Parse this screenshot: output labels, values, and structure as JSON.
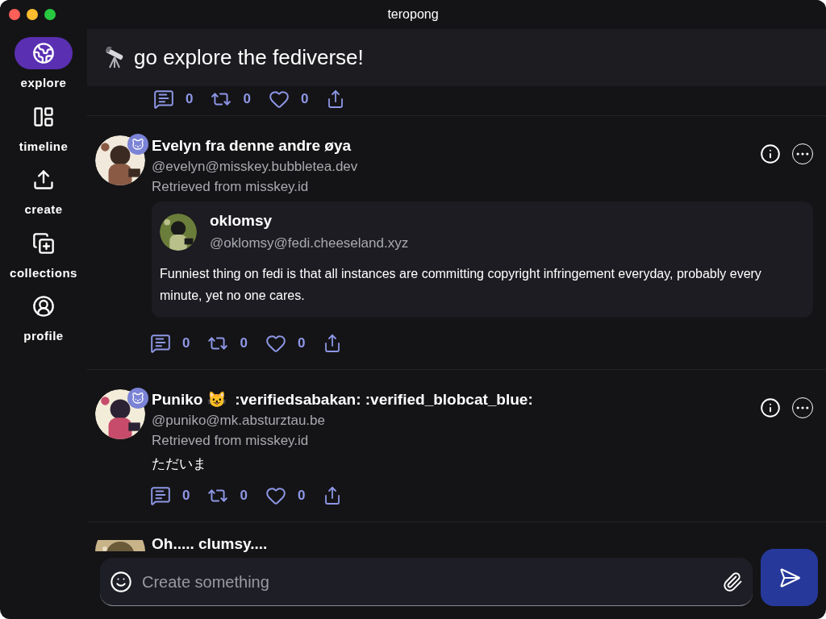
{
  "window": {
    "title": "teropong"
  },
  "sidebar": {
    "items": [
      {
        "label": "explore",
        "selected": true
      },
      {
        "label": "timeline",
        "selected": false
      },
      {
        "label": "create",
        "selected": false
      },
      {
        "label": "collections",
        "selected": false
      },
      {
        "label": "profile",
        "selected": false
      }
    ]
  },
  "header": {
    "title": "go explore the fediverse!"
  },
  "feed": [
    {
      "kind": "partial",
      "stats": {
        "replies": "0",
        "boosts": "0",
        "likes": "0"
      }
    },
    {
      "kind": "quote",
      "name": "Evelyn fra denne andre øya",
      "handle": "@evelyn@misskey.bubbletea.dev",
      "source": "Retrieved from misskey.id",
      "bot": true,
      "quote": {
        "name": "oklomsy",
        "handle": "@oklomsy@fedi.cheeseland.xyz",
        "text": "Funniest thing on fedi is that all instances are committing copyright infringement everyday, probably every minute, yet no one cares."
      },
      "stats": {
        "replies": "0",
        "boosts": "0",
        "likes": "0"
      }
    },
    {
      "kind": "text",
      "name": "Puniko 😺  :verifiedsabakan: :verified_blobcat_blue:",
      "handle": "@puniko@mk.absturztau.be",
      "source": "Retrieved from misskey.id",
      "bot": true,
      "text": "ただいま",
      "stats": {
        "replies": "0",
        "boosts": "0",
        "likes": "0"
      }
    },
    {
      "kind": "cut",
      "name": "Oh..... clumsy...."
    }
  ],
  "composer": {
    "placeholder": "Create something"
  }
}
